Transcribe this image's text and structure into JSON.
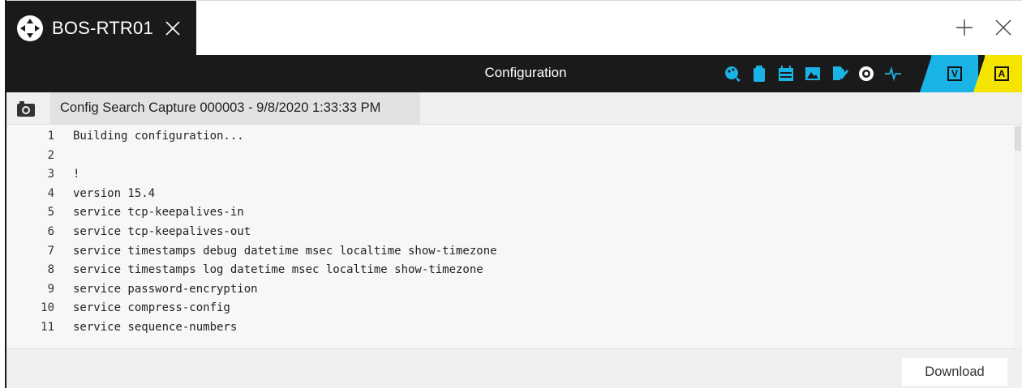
{
  "tab": {
    "title": "BOS-RTR01",
    "logo_icon": "network-logo-icon",
    "close_icon": "close-icon"
  },
  "window_controls": {
    "new_tab_icon": "plus-icon",
    "close_icon": "close-icon"
  },
  "titlebar": {
    "title": "Configuration",
    "tools": [
      "palette-icon",
      "clipboard-icon",
      "calendar-icon",
      "image-icon",
      "edit-icon",
      "eye-icon",
      "pulse-icon"
    ],
    "badges": [
      {
        "label": "V",
        "color": "#1ab3e6"
      },
      {
        "label": "A",
        "color": "#f5e400"
      }
    ],
    "accent_color": "#1ab3e6"
  },
  "capture": {
    "icon": "camera-icon",
    "label": "Config Search Capture 000003 - 9/8/2020 1:33:33 PM"
  },
  "code": {
    "lines": [
      {
        "n": "1",
        "text": "Building configuration..."
      },
      {
        "n": "2",
        "text": ""
      },
      {
        "n": "3",
        "text": "!"
      },
      {
        "n": "4",
        "text": "version 15.4"
      },
      {
        "n": "5",
        "text": "service tcp-keepalives-in"
      },
      {
        "n": "6",
        "text": "service tcp-keepalives-out"
      },
      {
        "n": "7",
        "text": "service timestamps debug datetime msec localtime show-timezone"
      },
      {
        "n": "8",
        "text": "service timestamps log datetime msec localtime show-timezone"
      },
      {
        "n": "9",
        "text": "service password-encryption"
      },
      {
        "n": "10",
        "text": "service compress-config"
      },
      {
        "n": "11",
        "text": "service sequence-numbers"
      }
    ]
  },
  "footer": {
    "download_label": "Download"
  }
}
